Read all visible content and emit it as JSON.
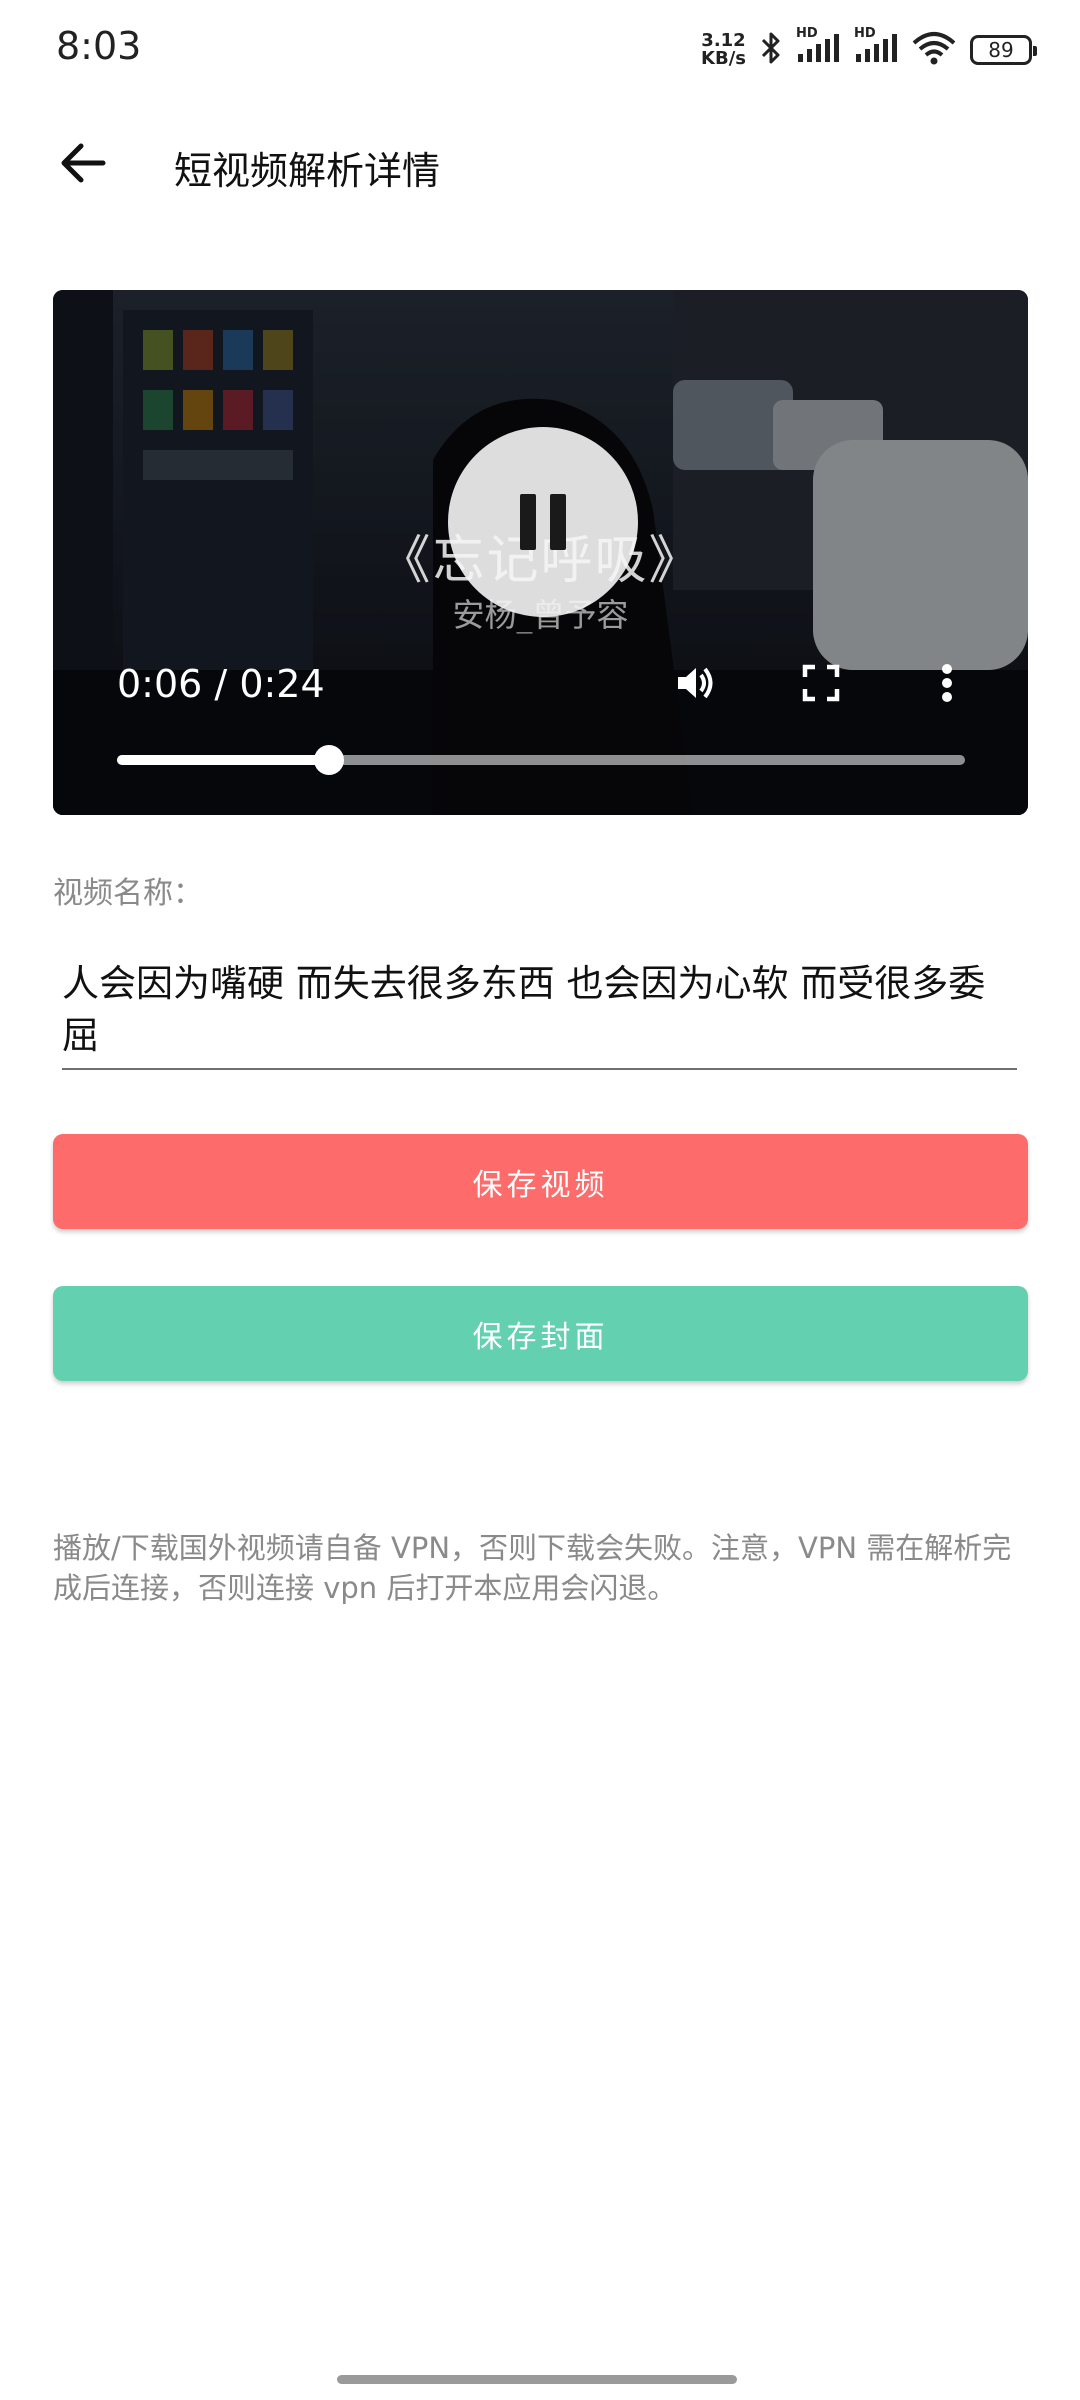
{
  "status_bar": {
    "time": "8:03",
    "net_speed_value": "3.12",
    "net_speed_unit": "KB/s",
    "signal_1_label": "HD",
    "signal_2_label": "HD",
    "battery": "89",
    "icons": [
      "bluetooth-icon",
      "signal-icon",
      "signal-icon",
      "wifi-icon",
      "battery-icon"
    ]
  },
  "header": {
    "back_icon": "arrow-left-icon",
    "title": "短视频解析详情"
  },
  "player": {
    "overlay_title": "《忘记呼吸》",
    "overlay_artist": "安杨_曾予容",
    "current_time": "0:06",
    "time_separator": " / ",
    "duration": "0:24",
    "progress": 0.25,
    "icons": [
      "pause-icon",
      "volume-icon",
      "fullscreen-icon",
      "more-vert-icon"
    ]
  },
  "form": {
    "name_label": "视频名称：",
    "name_value": "人会因为嘴硬 而失去很多东西 也会因为心软 而受很多委屈"
  },
  "buttons": {
    "save_video": "保存视频",
    "save_cover": "保存封面"
  },
  "notice": "播放/下载国外视频请自备 VPN，否则下载会失败。注意，VPN 需在解析完成后连接，否则连接 vpn 后打开本应用会闪退。",
  "colors": {
    "save_video_bg": "#fd6b6b",
    "save_cover_bg": "#63d1b0",
    "label_gray": "#8a8a8a"
  }
}
